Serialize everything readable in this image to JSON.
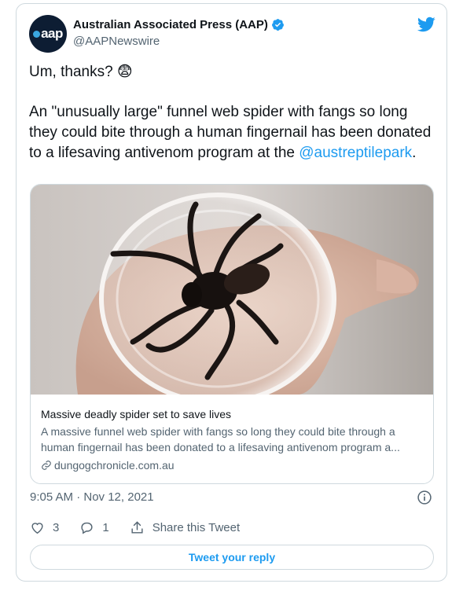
{
  "author": {
    "avatar_text": "aap",
    "name": "Australian Associated Press (AAP)",
    "handle": "@AAPNewswire",
    "verified": true
  },
  "tweet": {
    "line1": "Um, thanks? 😨",
    "body": "An \"unusually large\" funnel web spider with fangs so long they could bite through a human fingernail has been donated to a lifesaving antivenom program at the ",
    "mention": "@austreptilepark",
    "end": "."
  },
  "link_card": {
    "title": "Massive deadly spider set to save lives",
    "description": "A massive funnel web spider with fangs so long they could bite through a human fingernail has been donated to a lifesaving antivenom program a...",
    "domain": "dungogchronicle.com.au"
  },
  "timestamp": "9:05 AM · Nov 12, 2021",
  "actions": {
    "like_count": "3",
    "reply_count": "1",
    "share_label": "Share this Tweet"
  },
  "reply_button": "Tweet your reply",
  "colors": {
    "accent": "#1d9bf0",
    "secondary": "#536471",
    "border": "#cfd9de",
    "like": "#f91880"
  }
}
